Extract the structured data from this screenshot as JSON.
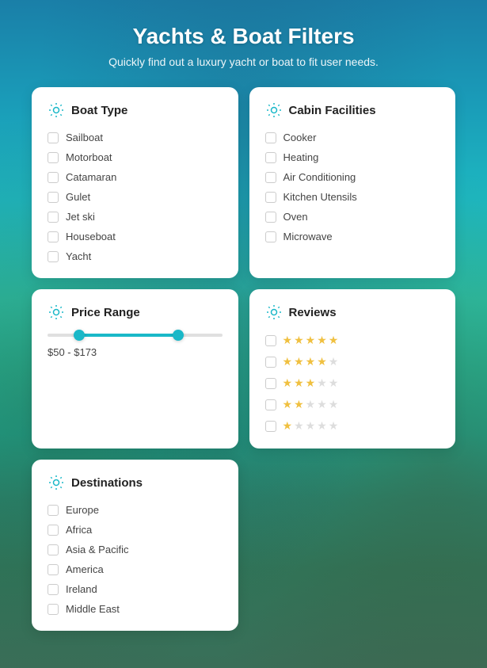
{
  "page": {
    "title": "Yachts & Boat Filters",
    "subtitle": "Quickly find out a luxury yacht or boat to fit user needs."
  },
  "boatType": {
    "title": "Boat Type",
    "items": [
      "Sailboat",
      "Motorboat",
      "Catamaran",
      "Gulet",
      "Jet ski",
      "Houseboat",
      "Yacht"
    ]
  },
  "cabinFacilities": {
    "title": "Cabin Facilities",
    "items": [
      "Cooker",
      "Heating",
      "Air Conditioning",
      "Kitchen Utensils",
      "Oven",
      "Microwave"
    ]
  },
  "priceRange": {
    "title": "Price Range",
    "value": "$50 - $173"
  },
  "reviews": {
    "title": "Reviews",
    "stars": [
      5,
      4,
      3,
      2,
      1
    ]
  },
  "destinations": {
    "title": "Destinations",
    "items": [
      "Europe",
      "Africa",
      "Asia & Pacific",
      "America",
      "Ireland",
      "Middle East"
    ]
  }
}
